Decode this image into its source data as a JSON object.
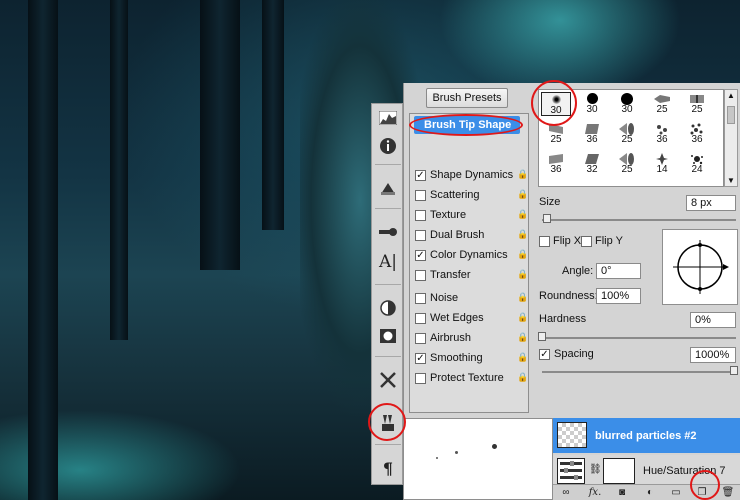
{
  "brush_panel": {
    "presets_button": "Brush Presets",
    "selected_option": "Brush Tip Shape",
    "options": [
      {
        "label": "Shape Dynamics",
        "checked": true
      },
      {
        "label": "Scattering",
        "checked": false
      },
      {
        "label": "Texture",
        "checked": false
      },
      {
        "label": "Dual Brush",
        "checked": false
      },
      {
        "label": "Color Dynamics",
        "checked": true
      },
      {
        "label": "Transfer",
        "checked": false
      },
      {
        "label": "Noise",
        "checked": false
      },
      {
        "label": "Wet Edges",
        "checked": false
      },
      {
        "label": "Airbrush",
        "checked": false
      },
      {
        "label": "Smoothing",
        "checked": true
      },
      {
        "label": "Protect Texture",
        "checked": false
      }
    ],
    "brush_tips": [
      "30",
      "30",
      "30",
      "25",
      "25",
      "25",
      "36",
      "25",
      "36",
      "36",
      "36",
      "32",
      "25",
      "14",
      "24"
    ],
    "size_label": "Size",
    "size_value": "8 px",
    "flip_x_label": "Flip X",
    "flip_y_label": "Flip Y",
    "angle_label": "Angle:",
    "angle_value": "0°",
    "roundness_label": "Roundness:",
    "roundness_value": "100%",
    "hardness_label": "Hardness",
    "hardness_value": "0%",
    "spacing_label": "Spacing",
    "spacing_value": "1000%",
    "spacing_checked": true
  },
  "layers": {
    "items": [
      {
        "name": "blurred particles #2",
        "selected": true
      },
      {
        "name": "Hue/Saturation 7",
        "selected": false
      }
    ],
    "fx_label": "fx."
  },
  "colors": {
    "selection_blue": "#3b8ee8",
    "annotation_red": "#e01818",
    "panel_gray": "#d4d4d4"
  },
  "toolstrip_icons": [
    "histogram-icon",
    "info-icon",
    "brush-preset-icon",
    "clone-source-icon",
    "character-icon",
    "adjustment-icon",
    "mask-icon",
    "tools-icon",
    "brush-panel-icon",
    "paragraph-icon"
  ]
}
